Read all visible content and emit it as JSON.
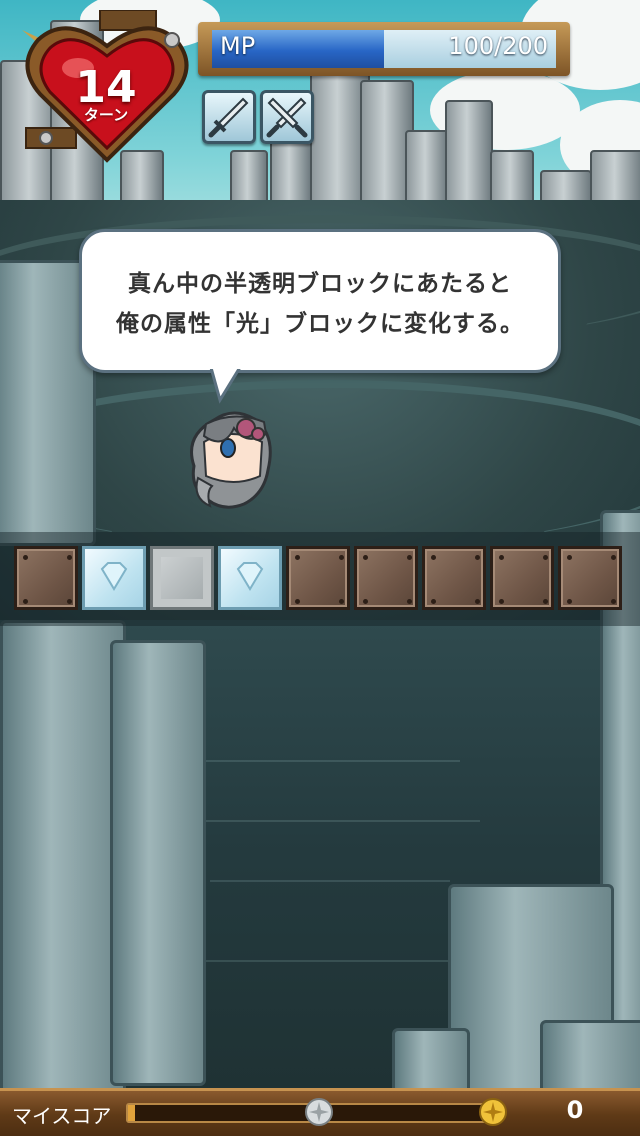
{
  "hud": {
    "turns": {
      "value": "14",
      "label": "ターン"
    },
    "mp": {
      "label": "MP",
      "current": 100,
      "max": 200,
      "text": "100/200"
    },
    "weapons": [
      "sword-icon",
      "crossed-swords-icon"
    ]
  },
  "dialog": {
    "lines": [
      "真ん中の半透明ブロックにあたると",
      "俺の属性「光」ブロックに変化する。"
    ]
  },
  "blocks": [
    "brown",
    "ice",
    "ghost",
    "ice",
    "brown",
    "brown",
    "brown",
    "brown",
    "brown"
  ],
  "score": {
    "label": "マイスコア",
    "value": "0",
    "progress": 0.02
  },
  "colors": {
    "mp_fill": "#2866c6",
    "heart": "#c8101c",
    "bar": "#5f3a17"
  }
}
